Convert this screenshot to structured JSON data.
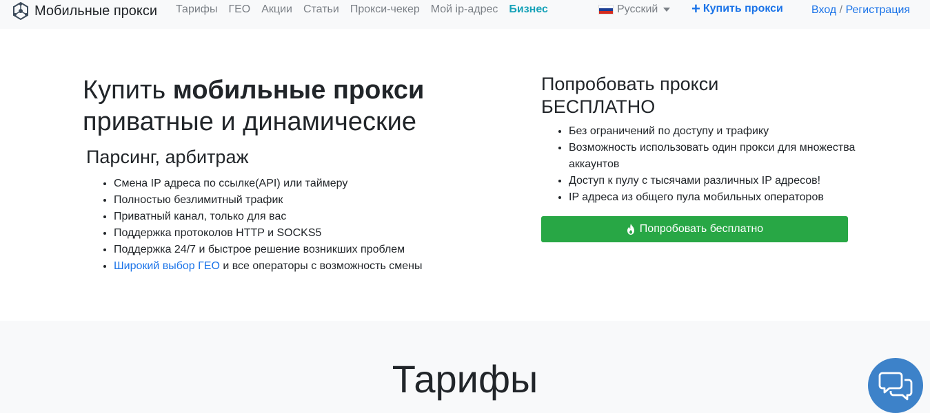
{
  "navbar": {
    "brand": "Мобильные прокси",
    "links": [
      "Тарифы",
      "ГЕО",
      "Акции",
      "Статьи",
      "Прокси-чекер",
      "Мой ip-адрес"
    ],
    "business": "Бизнес",
    "language": "Русский",
    "buy": "Купить прокси",
    "login": "Вход",
    "separator": "/",
    "register": "Регистрация"
  },
  "hero": {
    "title_plain": "Купить ",
    "title_bold": "мобильные прокси",
    "title_rest": "приватные и динамические",
    "subtitle": "Парсинг, арбитраж",
    "features": [
      "Смена IP адреса по ссылке(API) или таймеру",
      "Полностью безлимитный трафик",
      "Приватный канал, только для вас",
      "Поддержка протоколов HTTP и SOCKS5",
      "Поддержка 24/7 и быстрое решение возникших проблем"
    ],
    "last_feature_link": "Широкий выбор ГЕО",
    "last_feature_rest": " и все операторы с возможность смены"
  },
  "trial": {
    "title_line1": "Попробовать прокси",
    "title_line2": "БЕСПЛАТНО",
    "features": [
      "Без ограничений по доступу и трафику",
      "Возможность использовать один прокси для множества аккаунтов",
      "Доступ к пулу с тысячами различных IP адресов!",
      "IP адреса из общего пула мобильных операторов"
    ],
    "button": "Попробовать бесплатно"
  },
  "section2": {
    "title": "Тарифы"
  },
  "colors": {
    "accent": "#1a73e8",
    "business": "#17a2b8",
    "success": "#28a745",
    "chat": "#3d82c9"
  },
  "icons": {
    "brand": "network-logo-icon",
    "buy": "plus-icon",
    "trial_button": "fire-icon",
    "chat": "chat-bubbles-icon",
    "language": "russian-flag-icon"
  }
}
